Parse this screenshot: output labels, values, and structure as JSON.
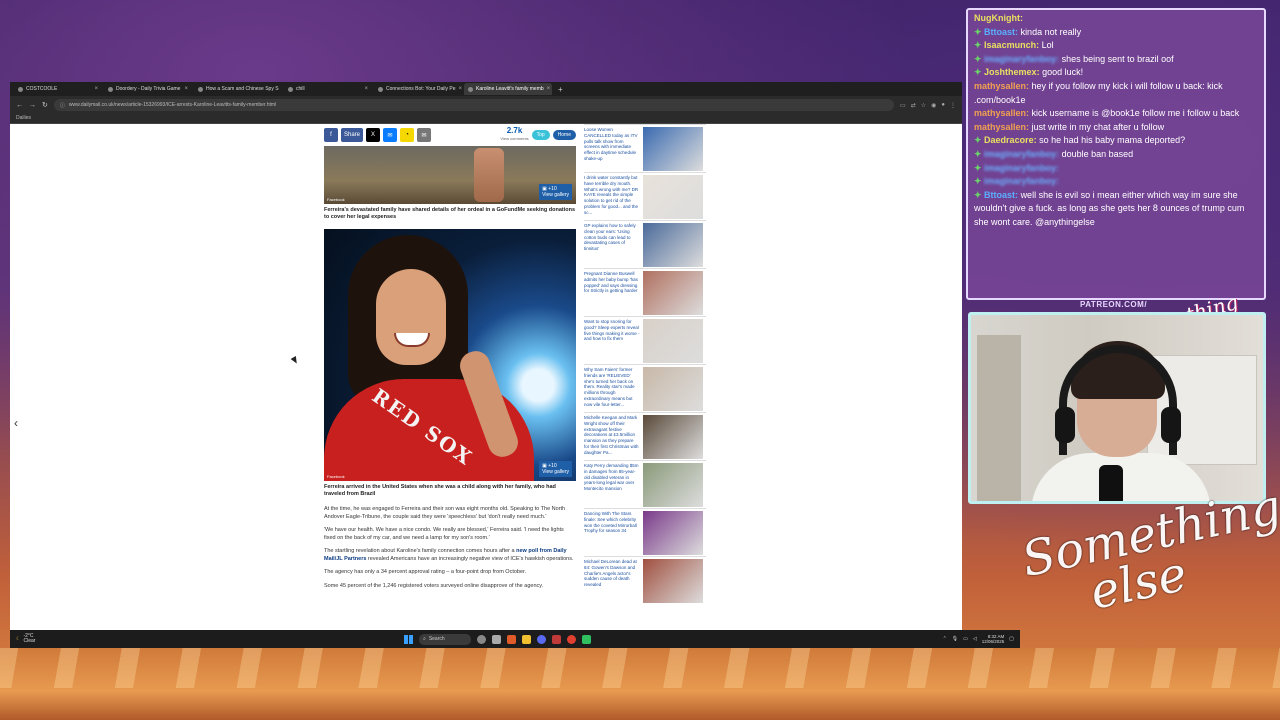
{
  "browser": {
    "tabs": [
      {
        "label": "COSTCOOLE",
        "active": false
      },
      {
        "label": "Doordery - Daily Trivia Game",
        "active": false
      },
      {
        "label": "How a Scam and Chinese Spy S",
        "active": false
      },
      {
        "label": "chill",
        "active": false
      },
      {
        "label": "Connections Bot: Your Daily Pe",
        "active": false
      },
      {
        "label": "Karoline Leavitt's family memb",
        "active": true
      }
    ],
    "url": "www.dailymail.co.uk/news/article-15326993/ICE-arrests-Karoline-Leavitts-family-member.html",
    "bookmark": "Dailies"
  },
  "article": {
    "share_label": "Share",
    "share_count": "2.7k",
    "share_count_label": "View comments",
    "top_label": "Top",
    "home_label": "Home",
    "photo1_credit": "Facebook",
    "gallery_count": "+10",
    "gallery_label": "View gallery",
    "caption1": "Ferreira's devastated family have shared details of her ordeal in a GoFundMe seeking donations to cover her legal expenses",
    "photo2_credit": "Facebook",
    "photo2_shirt_text": "RED SOX",
    "caption2": "Ferreira arrived in the United States when she was a child along with her family, who had traveled from Brazil",
    "p1": "At the time, he was engaged to Ferreira and their son was eight months old. Speaking to The North Andover Eagle-Tribune, the couple said they were 'speechless' but 'don't really need much.'",
    "p2": "'We have our health. We have a nice condo. We really are blessed,' Ferreira said. 'I need the lights fixed on the back of my car, and we need a lamp for my son's room.'",
    "p3_pre": "The startling revelation about Karoline's family connection comes hours after a ",
    "p3_link": "new poll from Daily Mail/JL Partners",
    "p3_post": " revealed Americans have an increasingly negative view of ICE's hawkish operations.",
    "p4": "The agency has only a 34 percent approval rating – a four-point drop from October.",
    "p5": "Some 45 percent of the 1,246 registered voters surveyed online disapprove of the agency."
  },
  "sidebar": [
    {
      "text": "Loose Women CANCELLED today as ITV pulls talk show from screens with immediate effect in daytime schedule shake-up",
      "thumb": "#3a6ab0"
    },
    {
      "tag": "",
      "text": "I drink water constantly but have terrible dry mouth. What's wrong with me? DR KAYE reveals the simple solution to get rid of the problem for good... and the sc...",
      "thumb": "#e8e2da"
    },
    {
      "text": "GP explains how to safely clean your ears: 'Using cotton buds can lead to devastating cases of tinnitus'",
      "thumb": "#4a6a9a"
    },
    {
      "text": "Pregnant Dianne Buswell admits her baby bump 'has popped' and says dressing for Strictly is getting harder",
      "thumb": "#b07060"
    },
    {
      "text": "Want to stop snoring for good? Sleep experts reveal five things making it worse - and how to fix them",
      "thumb": "#d8d0c8"
    },
    {
      "tag": "",
      "text": "Why Sam Faiers' former friends are 'RELIEVED' she's turned her back on them. Reality star's made millions through extraordinary means but now vile four-letter...",
      "thumb": "#c8b8a8"
    },
    {
      "text": "Michelle Keegan and Mark Wright show off their extravagant festive decorations at £3.5million mansion as they prepare for their first Christmas with daughter Pa...",
      "thumb": "#5a4a3a"
    },
    {
      "text": "Katy Perry demanding $5m in damages from 85-year-old disabled veteran in years-long legal war over Montecito mansion",
      "thumb": "#8a9a7a"
    },
    {
      "text": "Dancing With The Stars finale: See which celebrity won the coveted Mirrorball Trophy for season 34",
      "thumb": "#7a3a8a"
    },
    {
      "text": "Michael DeLorean dead at 84: Gowen's Dawson and Charlie's Angels actor's sudden cause of death revealed",
      "thumb": "#a05040"
    }
  ],
  "taskbar": {
    "temp": "-2°C",
    "weather": "Clear",
    "search": "Search",
    "time": "8:32 AM",
    "date": "12/06/2025"
  },
  "chat": {
    "messages": [
      {
        "user": "NugKnight:",
        "user_color": "#e8e060",
        "badge": false,
        "text": "",
        "blur": false
      },
      {
        "user": "Bttoast:",
        "user_color": "#5ab0ff",
        "badge": true,
        "text": "kinda not really",
        "blur": false
      },
      {
        "user": "Isaacmunch:",
        "user_color": "#e8e060",
        "badge": true,
        "text": "Lol",
        "blur": false
      },
      {
        "user": "imaginaryfanboy:",
        "user_color": "#6ab0ff",
        "badge": true,
        "text": "shes being sent to brazil oof",
        "blur": true
      },
      {
        "user": "Joshthemex:",
        "user_color": "#e8e060",
        "badge": true,
        "text": "good luck!",
        "blur": false
      },
      {
        "user": "mathysallen:",
        "user_color": "#f0a050",
        "badge": false,
        "text": "hey if you follow my kick i will follow u back: kick .com/book1e",
        "blur": false
      },
      {
        "user": "mathysallen:",
        "user_color": "#f0a050",
        "badge": false,
        "text": "kick username is @book1e follow me i follow u back",
        "blur": false
      },
      {
        "user": "mathysallen:",
        "user_color": "#f0a050",
        "badge": false,
        "text": "just write in my chat after u follow",
        "blur": false
      },
      {
        "user": "Daedracore:",
        "user_color": "#e8e060",
        "badge": true,
        "text": "so he had his baby mama deported?",
        "blur": false
      },
      {
        "user": "imaginaryfanboy:",
        "user_color": "#6ab0ff",
        "badge": true,
        "text": "double ban based",
        "blur": true
      },
      {
        "user": "imaginaryfanboy:",
        "user_color": "#6ab0ff",
        "badge": true,
        "text": "",
        "blur": true
      },
      {
        "user": "imaginaryfanboy:",
        "user_color": "#6ab0ff",
        "badge": true,
        "text": "",
        "blur": true
      },
      {
        "user": "Bttoast:",
        "user_color": "#5ab0ff",
        "badge": true,
        "text": "well she is evil so i mean either which way im sure she wouldn't give a fuck. as long as she gets her 8 ounces of trump cum she wont care. @anythingelse",
        "blur": false
      }
    ]
  },
  "overlay": {
    "patreon": "PATREON.COM/",
    "logo_small": "Anything Else",
    "logo_big_line1": "Something",
    "logo_big_line2": "else"
  }
}
